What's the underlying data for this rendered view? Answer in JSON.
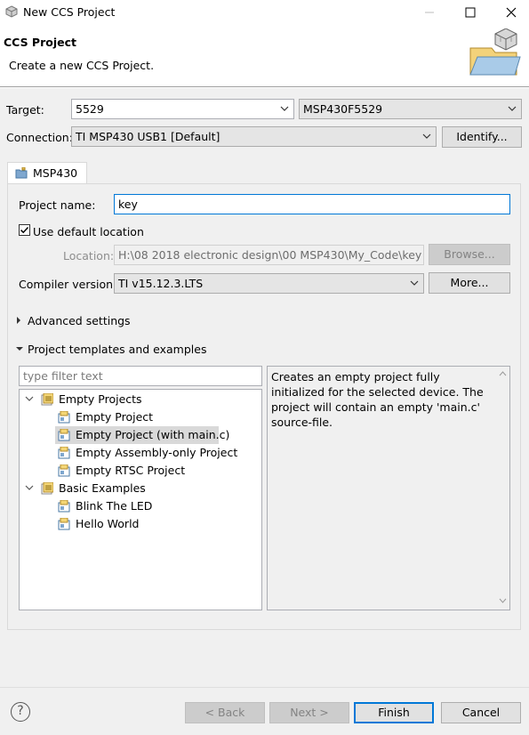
{
  "window": {
    "title": "New CCS Project"
  },
  "header": {
    "title": "CCS Project",
    "description": "Create a new CCS Project."
  },
  "target": {
    "label": "Target:",
    "value": "5529",
    "device": "MSP430F5529"
  },
  "connection": {
    "label": "Connection:",
    "value": "TI MSP430 USB1 [Default]",
    "identify_button": "Identify..."
  },
  "tab": {
    "label": "MSP430"
  },
  "project": {
    "name_label": "Project name:",
    "name_value": "key",
    "use_default_location_label": "Use default location",
    "use_default_location_checked": true,
    "location_label": "Location:",
    "location_value": "H:\\08 2018 electronic design\\00 MSP430\\My_Code\\key",
    "browse_button": "Browse...",
    "compiler_label": "Compiler version:",
    "compiler_value": "TI v15.12.3.LTS",
    "more_button": "More..."
  },
  "sections": {
    "advanced": "Advanced settings",
    "templates": "Project templates and examples"
  },
  "filter": {
    "placeholder": "type filter text"
  },
  "tree": {
    "group1": "Empty Projects",
    "item1": "Empty Project",
    "item2": "Empty Project (with main.c)",
    "item3": "Empty Assembly-only Project",
    "item4": "Empty RTSC Project",
    "group2": "Basic Examples",
    "item5": "Blink The LED",
    "item6": "Hello World"
  },
  "description_text": "Creates an empty project fully initialized for the selected device. The project will contain an empty 'main.c' source-file.",
  "footer": {
    "back": "< Back",
    "next": "Next >",
    "finish": "Finish",
    "cancel": "Cancel"
  },
  "colors": {
    "accent": "#0078d7",
    "selection": "#d9d9d9",
    "dialog_bg": "#f0f0f0"
  }
}
